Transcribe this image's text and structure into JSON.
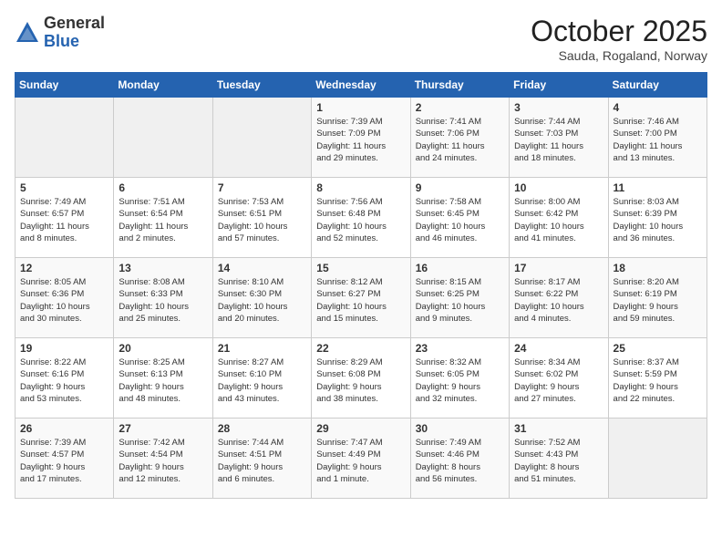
{
  "logo": {
    "general": "General",
    "blue": "Blue"
  },
  "title": "October 2025",
  "subtitle": "Sauda, Rogaland, Norway",
  "days_header": [
    "Sunday",
    "Monday",
    "Tuesday",
    "Wednesday",
    "Thursday",
    "Friday",
    "Saturday"
  ],
  "weeks": [
    [
      {
        "day": "",
        "info": ""
      },
      {
        "day": "",
        "info": ""
      },
      {
        "day": "",
        "info": ""
      },
      {
        "day": "1",
        "info": "Sunrise: 7:39 AM\nSunset: 7:09 PM\nDaylight: 11 hours\nand 29 minutes."
      },
      {
        "day": "2",
        "info": "Sunrise: 7:41 AM\nSunset: 7:06 PM\nDaylight: 11 hours\nand 24 minutes."
      },
      {
        "day": "3",
        "info": "Sunrise: 7:44 AM\nSunset: 7:03 PM\nDaylight: 11 hours\nand 18 minutes."
      },
      {
        "day": "4",
        "info": "Sunrise: 7:46 AM\nSunset: 7:00 PM\nDaylight: 11 hours\nand 13 minutes."
      }
    ],
    [
      {
        "day": "5",
        "info": "Sunrise: 7:49 AM\nSunset: 6:57 PM\nDaylight: 11 hours\nand 8 minutes."
      },
      {
        "day": "6",
        "info": "Sunrise: 7:51 AM\nSunset: 6:54 PM\nDaylight: 11 hours\nand 2 minutes."
      },
      {
        "day": "7",
        "info": "Sunrise: 7:53 AM\nSunset: 6:51 PM\nDaylight: 10 hours\nand 57 minutes."
      },
      {
        "day": "8",
        "info": "Sunrise: 7:56 AM\nSunset: 6:48 PM\nDaylight: 10 hours\nand 52 minutes."
      },
      {
        "day": "9",
        "info": "Sunrise: 7:58 AM\nSunset: 6:45 PM\nDaylight: 10 hours\nand 46 minutes."
      },
      {
        "day": "10",
        "info": "Sunrise: 8:00 AM\nSunset: 6:42 PM\nDaylight: 10 hours\nand 41 minutes."
      },
      {
        "day": "11",
        "info": "Sunrise: 8:03 AM\nSunset: 6:39 PM\nDaylight: 10 hours\nand 36 minutes."
      }
    ],
    [
      {
        "day": "12",
        "info": "Sunrise: 8:05 AM\nSunset: 6:36 PM\nDaylight: 10 hours\nand 30 minutes."
      },
      {
        "day": "13",
        "info": "Sunrise: 8:08 AM\nSunset: 6:33 PM\nDaylight: 10 hours\nand 25 minutes."
      },
      {
        "day": "14",
        "info": "Sunrise: 8:10 AM\nSunset: 6:30 PM\nDaylight: 10 hours\nand 20 minutes."
      },
      {
        "day": "15",
        "info": "Sunrise: 8:12 AM\nSunset: 6:27 PM\nDaylight: 10 hours\nand 15 minutes."
      },
      {
        "day": "16",
        "info": "Sunrise: 8:15 AM\nSunset: 6:25 PM\nDaylight: 10 hours\nand 9 minutes."
      },
      {
        "day": "17",
        "info": "Sunrise: 8:17 AM\nSunset: 6:22 PM\nDaylight: 10 hours\nand 4 minutes."
      },
      {
        "day": "18",
        "info": "Sunrise: 8:20 AM\nSunset: 6:19 PM\nDaylight: 9 hours\nand 59 minutes."
      }
    ],
    [
      {
        "day": "19",
        "info": "Sunrise: 8:22 AM\nSunset: 6:16 PM\nDaylight: 9 hours\nand 53 minutes."
      },
      {
        "day": "20",
        "info": "Sunrise: 8:25 AM\nSunset: 6:13 PM\nDaylight: 9 hours\nand 48 minutes."
      },
      {
        "day": "21",
        "info": "Sunrise: 8:27 AM\nSunset: 6:10 PM\nDaylight: 9 hours\nand 43 minutes."
      },
      {
        "day": "22",
        "info": "Sunrise: 8:29 AM\nSunset: 6:08 PM\nDaylight: 9 hours\nand 38 minutes."
      },
      {
        "day": "23",
        "info": "Sunrise: 8:32 AM\nSunset: 6:05 PM\nDaylight: 9 hours\nand 32 minutes."
      },
      {
        "day": "24",
        "info": "Sunrise: 8:34 AM\nSunset: 6:02 PM\nDaylight: 9 hours\nand 27 minutes."
      },
      {
        "day": "25",
        "info": "Sunrise: 8:37 AM\nSunset: 5:59 PM\nDaylight: 9 hours\nand 22 minutes."
      }
    ],
    [
      {
        "day": "26",
        "info": "Sunrise: 7:39 AM\nSunset: 4:57 PM\nDaylight: 9 hours\nand 17 minutes."
      },
      {
        "day": "27",
        "info": "Sunrise: 7:42 AM\nSunset: 4:54 PM\nDaylight: 9 hours\nand 12 minutes."
      },
      {
        "day": "28",
        "info": "Sunrise: 7:44 AM\nSunset: 4:51 PM\nDaylight: 9 hours\nand 6 minutes."
      },
      {
        "day": "29",
        "info": "Sunrise: 7:47 AM\nSunset: 4:49 PM\nDaylight: 9 hours\nand 1 minute."
      },
      {
        "day": "30",
        "info": "Sunrise: 7:49 AM\nSunset: 4:46 PM\nDaylight: 8 hours\nand 56 minutes."
      },
      {
        "day": "31",
        "info": "Sunrise: 7:52 AM\nSunset: 4:43 PM\nDaylight: 8 hours\nand 51 minutes."
      },
      {
        "day": "",
        "info": ""
      }
    ]
  ]
}
